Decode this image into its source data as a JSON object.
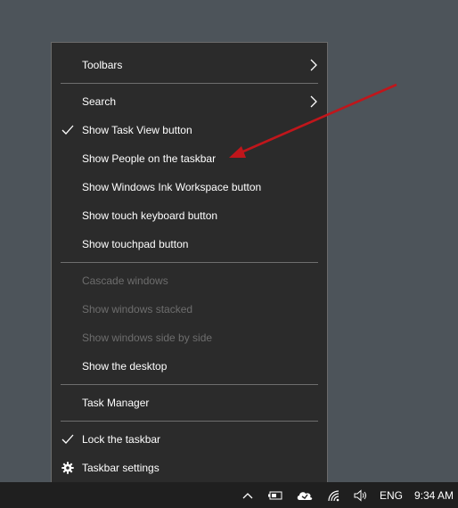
{
  "context_menu": {
    "items": [
      {
        "label": "Toolbars"
      },
      {
        "label": "Search"
      },
      {
        "label": "Show Task View button"
      },
      {
        "label": "Show People on the taskbar"
      },
      {
        "label": "Show Windows Ink Workspace button"
      },
      {
        "label": "Show touch keyboard button"
      },
      {
        "label": "Show touchpad button"
      },
      {
        "label": "Cascade windows"
      },
      {
        "label": "Show windows stacked"
      },
      {
        "label": "Show windows side by side"
      },
      {
        "label": "Show the desktop"
      },
      {
        "label": "Task Manager"
      },
      {
        "label": "Lock the taskbar"
      },
      {
        "label": "Taskbar settings"
      }
    ]
  },
  "taskbar": {
    "language": "ENG",
    "time": "9:34 AM"
  },
  "colors": {
    "desktop": "#4d545a",
    "menu_bg": "#2b2b2b",
    "disabled_text": "#6d6d6d",
    "annotation_arrow": "#c0161b"
  },
  "icons": [
    "chevron-right-icon",
    "checkmark-icon",
    "gear-icon",
    "chevron-up-icon",
    "battery-icon",
    "onedrive-icon",
    "wifi-icon",
    "volume-icon"
  ]
}
